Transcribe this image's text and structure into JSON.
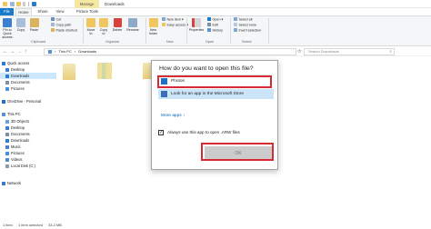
{
  "window": {
    "context_tab": "Manage",
    "title": "Downloads"
  },
  "tabs": [
    "File",
    "Home",
    "Share",
    "View",
    "Picture Tools"
  ],
  "ribbon": {
    "clipboard": {
      "pin_label": "Pin to Quick access",
      "copy_label": "Copy",
      "paste_label": "Paste",
      "cut_label": "Cut",
      "copy_path_label": "Copy path",
      "paste_shortcut_label": "Paste shortcut",
      "group_label": "Clipboard"
    },
    "organize": {
      "move_to_label": "Move to",
      "copy_to_label": "Copy to",
      "delete_label": "Delete",
      "rename_label": "Rename",
      "group_label": "Organize"
    },
    "new": {
      "new_folder_label": "New folder",
      "new_item_label": "New item ▾",
      "easy_access_label": "Easy access ▾",
      "group_label": "New"
    },
    "open": {
      "properties_label": "Properties",
      "open_label": "Open ▾",
      "edit_label": "Edit",
      "history_label": "History",
      "group_label": "Open"
    },
    "select": {
      "select_all_label": "Select all",
      "select_none_label": "Select none",
      "invert_label": "Invert selection",
      "group_label": "Select"
    }
  },
  "address": {
    "path": [
      "This PC",
      "Downloads"
    ],
    "search_placeholder": "Search Downloads"
  },
  "nav": {
    "items": [
      {
        "label": "Quick access",
        "color": "#2f7ad0",
        "indent": 0
      },
      {
        "label": "Desktop",
        "color": "#3a7bd5",
        "indent": 1
      },
      {
        "label": "Downloads",
        "color": "#2f7ad0",
        "indent": 1,
        "selected": true
      },
      {
        "label": "Documents",
        "color": "#7f8ea3",
        "indent": 1
      },
      {
        "label": "Pictures",
        "color": "#4a90d9",
        "indent": 1
      },
      {
        "label": "OneDrive - Personal",
        "color": "#1f6fc5",
        "indent": 0
      },
      {
        "label": "This PC",
        "color": "#5a8fd0",
        "indent": 0
      },
      {
        "label": "3D Objects",
        "color": "#6aa0d8",
        "indent": 1
      },
      {
        "label": "Desktop",
        "color": "#3a7bd5",
        "indent": 1
      },
      {
        "label": "Documents",
        "color": "#7f8ea3",
        "indent": 1
      },
      {
        "label": "Downloads",
        "color": "#2f7ad0",
        "indent": 1
      },
      {
        "label": "Music",
        "color": "#4a7fcf",
        "indent": 1
      },
      {
        "label": "Pictures",
        "color": "#4a90d9",
        "indent": 1
      },
      {
        "label": "Videos",
        "color": "#5a86c7",
        "indent": 1
      },
      {
        "label": "Local Disk (C:)",
        "color": "#8c9aa8",
        "indent": 1
      },
      {
        "label": "Network",
        "color": "#3c78c6",
        "indent": 0
      }
    ]
  },
  "status": {
    "count": "1 item",
    "selected": "1 item selected",
    "size": "33.2 MB"
  },
  "dialog": {
    "title": "How do you want to open this file?",
    "apps": [
      {
        "name": "Photos",
        "icon": "photos-icon",
        "color": "#1a73c8"
      },
      {
        "name": "Look for an app in the Microsoft Store",
        "icon": "store-icon",
        "color": "#3a6fb5"
      }
    ],
    "more_apps": "More apps ↓",
    "always_use": "Always use this app to open .ARW files",
    "always_checked": "✓",
    "ok_label": "OK"
  },
  "colors": {
    "accent": "#1979ca",
    "highlight": "#d62b35",
    "selection": "#cce4f7"
  }
}
